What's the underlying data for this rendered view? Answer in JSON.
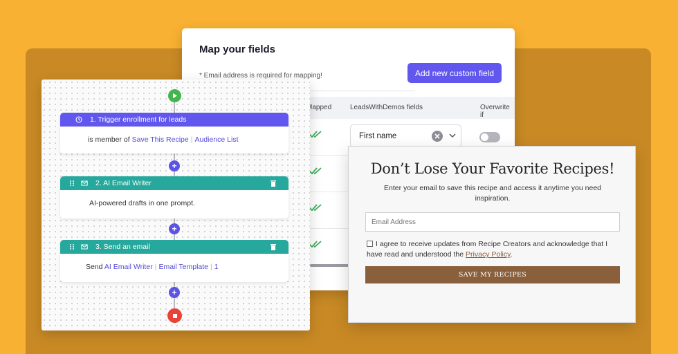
{
  "mapping": {
    "title": "Map your fields",
    "note": "* Email address is required for mapping!",
    "add_button": "Add new custom field",
    "columns": [
      "Mapped",
      "LeadsWithDemos fields",
      "Overwrite if"
    ],
    "first_field": "First name",
    "overwrite_enabled": false,
    "check_color": "#3fae5a"
  },
  "workflow": {
    "steps": [
      {
        "title": "1. Trigger enrollment for leads",
        "icon": "clock-icon",
        "body_prefix": "is member of",
        "links": [
          "Save This Recipe",
          "Audience List"
        ]
      },
      {
        "title": "2. AI Email Writer",
        "icon": "mail-icon",
        "body": "AI-powered drafts in one prompt."
      },
      {
        "title": "3. Send an email",
        "icon": "mail-icon",
        "body_prefix": "Send",
        "links": [
          "AI Email Writer",
          "Email Template",
          "1"
        ]
      }
    ],
    "colors": {
      "trigger": "#6157ef",
      "action": "#26a89c",
      "start": "#42b54e",
      "stop": "#ea4238",
      "add": "#5a53e4"
    }
  },
  "signup": {
    "title": "Don’t Lose Your Favorite Recipes!",
    "subtitle": "Enter your email to save this recipe and access it anytime you need inspiration.",
    "email_placeholder": "Email Address",
    "consent_text": "I agree to receive updates from Recipe Creators and acknowledge that I have read and understood the",
    "policy_link": "Privacy Policy",
    "submit_label": "SAVE MY RECIPES",
    "button_color": "#8a5f3b"
  }
}
